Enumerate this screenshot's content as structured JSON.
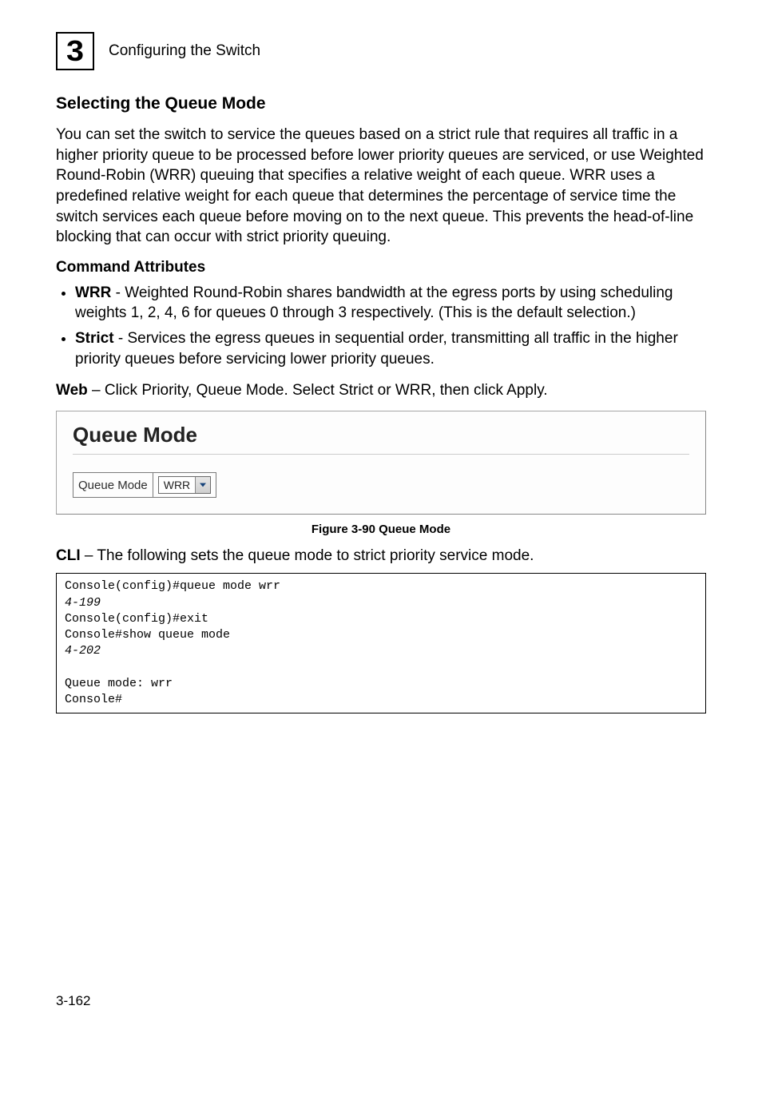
{
  "header": {
    "chapter_number": "3",
    "chapter_title": "Configuring the Switch"
  },
  "section": {
    "heading": "Selecting the Queue Mode",
    "paragraph": "You can set the switch to service the queues based on a strict rule that requires all traffic in a higher priority queue to be processed before lower priority queues are serviced, or use Weighted Round-Robin (WRR) queuing that specifies a relative weight of each queue. WRR uses a predefined relative weight for each queue that determines the percentage of service time the switch services each queue before moving on to the next queue. This prevents the head-of-line blocking that can occur with strict priority queuing."
  },
  "command_attributes": {
    "heading": "Command Attributes",
    "items": [
      {
        "term": "WRR",
        "desc": " - Weighted Round-Robin shares bandwidth at the egress ports by using scheduling weights 1, 2, 4, 6 for queues 0 through 3 respectively. (This is the default selection.)"
      },
      {
        "term": "Strict",
        "desc": " - Services the egress queues in sequential order, transmitting all traffic in the higher priority queues before servicing lower priority queues."
      }
    ]
  },
  "web_line": {
    "label": "Web",
    "text": " – Click Priority, Queue Mode. Select Strict or WRR, then click Apply."
  },
  "screenshot": {
    "title": "Queue Mode",
    "field_label": "Queue Mode",
    "select_value": "WRR"
  },
  "figure_caption": "Figure 3-90  Queue Mode",
  "cli_line": {
    "label": "CLI",
    "text": " – The following sets the queue mode to strict priority service mode."
  },
  "code": {
    "l1": "Console(config)#queue mode wrr",
    "l2": "4-199",
    "l3": "Console(config)#exit",
    "l4": "Console#show queue mode",
    "l5": "4-202",
    "l6": "",
    "l7": "Queue mode: wrr",
    "l8": "Console#"
  },
  "footer": {
    "page": "3-162"
  }
}
